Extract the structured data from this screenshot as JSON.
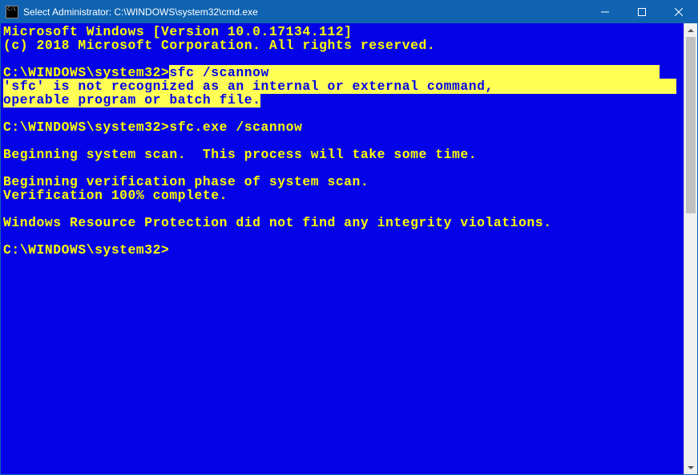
{
  "window": {
    "title": "Select Administrator: C:\\WINDOWS\\system32\\cmd.exe"
  },
  "terminal": {
    "line_version": "Microsoft Windows [Version 10.0.17134.112]",
    "line_copyright": "(c) 2018 Microsoft Corporation. All rights reserved.",
    "prompt1_prefix": "C:\\WINDOWS\\system32>",
    "prompt1_cmd": "sfc /scannow",
    "err_line1": "'sfc' is not recognized as an internal or external command,",
    "err_line2": "operable program or batch file.",
    "prompt2_prefix": "C:\\WINDOWS\\system32>",
    "prompt2_cmd": "sfc.exe /scannow",
    "scan_begin": "Beginning system scan.  This process will take some time.",
    "verif_begin": "Beginning verification phase of system scan.",
    "verif_done": "Verification 100% complete.",
    "wrp_result": "Windows Resource Protection did not find any integrity violations.",
    "prompt3": "C:\\WINDOWS\\system32>"
  }
}
